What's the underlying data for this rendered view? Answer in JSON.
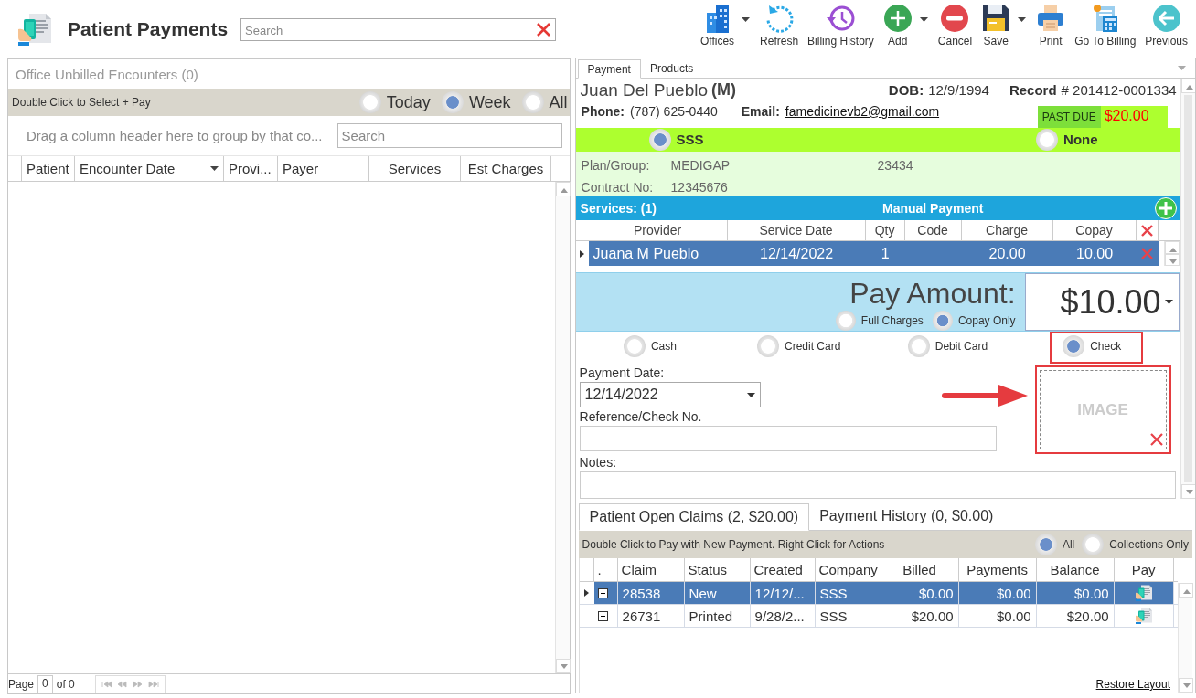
{
  "app": {
    "title": "Patient Payments",
    "search": {
      "placeholder": "Search"
    }
  },
  "toolbar": [
    {
      "label": "Offices",
      "kind": "building",
      "dropdown": true
    },
    {
      "label": "Refresh",
      "kind": "refresh",
      "dropdown": false
    },
    {
      "label": "Billing History",
      "kind": "history",
      "dropdown": false
    },
    {
      "label": "Add",
      "kind": "add",
      "dropdown": true
    },
    {
      "label": "Cancel",
      "kind": "cancel",
      "dropdown": false
    },
    {
      "label": "Save",
      "kind": "save",
      "dropdown": true
    },
    {
      "label": "Print",
      "kind": "print",
      "dropdown": false
    },
    {
      "label": "Go To Billing",
      "kind": "billing",
      "dropdown": false
    },
    {
      "label": "Previous",
      "kind": "previous",
      "dropdown": false
    }
  ],
  "unbilled": {
    "title": "Office Unbilled Encounters (0)",
    "hint": "Double Click to Select + Pay",
    "filters": [
      {
        "label": "Today",
        "selected": false
      },
      {
        "label": "Week",
        "selected": true
      },
      {
        "label": "All",
        "selected": false
      }
    ],
    "group_hint": "Drag a column header here to group by that co...",
    "search": {
      "placeholder": "Search"
    },
    "columns": [
      {
        "label": "Patient",
        "menu": false
      },
      {
        "label": "Encounter Date",
        "menu": true
      },
      {
        "label": "Provi...",
        "menu": false
      },
      {
        "label": "Payer",
        "menu": false
      },
      {
        "label": "Services",
        "menu": false
      },
      {
        "label": "Est Charges",
        "menu": false
      }
    ],
    "pager": {
      "label": "Page",
      "page": "0",
      "of": "of 0"
    }
  },
  "payment": {
    "tabs": [
      {
        "label": "Payment",
        "selected": true
      },
      {
        "label": "Products",
        "selected": false
      }
    ],
    "patient": {
      "name": "Juan Del Pueblo",
      "sex": "(M)",
      "dob_label": "DOB:",
      "dob": "12/9/1994",
      "record_label": "Record",
      "record": "# 201412-0001334",
      "phone_label": "Phone:",
      "phone": "(787) 625-0440",
      "email_label": "Email:",
      "email": "famedicinevb2@gmail.com",
      "past_due_label": "PAST DUE",
      "past_due": "$20.00"
    },
    "insurance": [
      {
        "label": "SSS",
        "selected": true
      },
      {
        "label": "None",
        "selected": false
      }
    ],
    "plan": {
      "plan_label": "Plan/Group:",
      "plan": "MEDIGAP",
      "group": "23434",
      "contract_label": "Contract No:",
      "contract": "12345676"
    },
    "services": {
      "title": "Services: (1)",
      "mode": "Manual Payment",
      "columns": [
        "Provider",
        "Service Date",
        "Qty",
        "Code",
        "Charge",
        "Copay"
      ],
      "rows": [
        {
          "cells": [
            "Juana M Pueblo",
            "12/14/2022",
            "1",
            "",
            "20.00",
            "10.00"
          ],
          "selected": true
        }
      ]
    },
    "pay_amount": {
      "label": "Pay Amount:",
      "value": "$10.00",
      "options": [
        {
          "label": "Full Charges",
          "selected": false
        },
        {
          "label": "Copay Only",
          "selected": true
        }
      ]
    },
    "methods": [
      {
        "label": "Cash",
        "selected": false,
        "highlighted": false
      },
      {
        "label": "Credit Card",
        "selected": false,
        "highlighted": false
      },
      {
        "label": "Debit Card",
        "selected": false,
        "highlighted": false
      },
      {
        "label": "Check",
        "selected": true,
        "highlighted": true
      }
    ],
    "payment_date": {
      "label": "Payment Date:",
      "value": "12/14/2022"
    },
    "reference": {
      "label": "Reference/Check No."
    },
    "notes": {
      "label": "Notes:"
    },
    "image_box": {
      "label": "IMAGE",
      "highlighted": true
    }
  },
  "claims": {
    "tabs": [
      {
        "label": "Patient Open Claims (2, $20.00)",
        "selected": true
      },
      {
        "label": "Payment History (0, $0.00)",
        "selected": false
      }
    ],
    "hint": "Double Click to Pay with New Payment. Right Click for Actions",
    "filters": [
      {
        "label": "All",
        "selected": true
      },
      {
        "label": "Collections Only",
        "selected": false
      }
    ],
    "columns": [
      ".",
      "Claim",
      "Status",
      "Created",
      "Company",
      "Billed",
      "Payments",
      "Balance",
      "Pay"
    ],
    "rows": [
      {
        "cells": [
          "",
          "28538",
          "New",
          "12/12/...",
          "SSS",
          "$0.00",
          "$0.00",
          "$0.00"
        ],
        "selected": true,
        "expanded": false
      },
      {
        "cells": [
          "",
          "26731",
          "Printed",
          "9/28/2...",
          "SSS",
          "$20.00",
          "$0.00",
          "$20.00"
        ],
        "selected": false,
        "expanded": false
      }
    ],
    "restore": "Restore Layout"
  }
}
